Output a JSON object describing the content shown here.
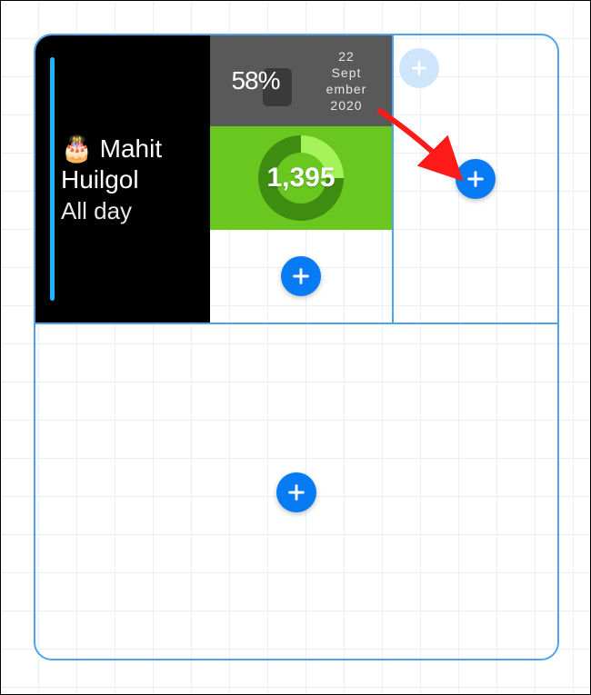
{
  "calendar": {
    "emoji": "🎂",
    "name_first": "Mahit",
    "name_last": "Huilgol",
    "duration": "All day"
  },
  "battery": {
    "percent_label": "58%"
  },
  "date": {
    "lines": "22\nSept\nember\n2020"
  },
  "activity": {
    "value": "1,395"
  },
  "colors": {
    "accent": "#067bf4",
    "slot_border": "#4ea3f0",
    "activity_bg": "#6ac720"
  }
}
